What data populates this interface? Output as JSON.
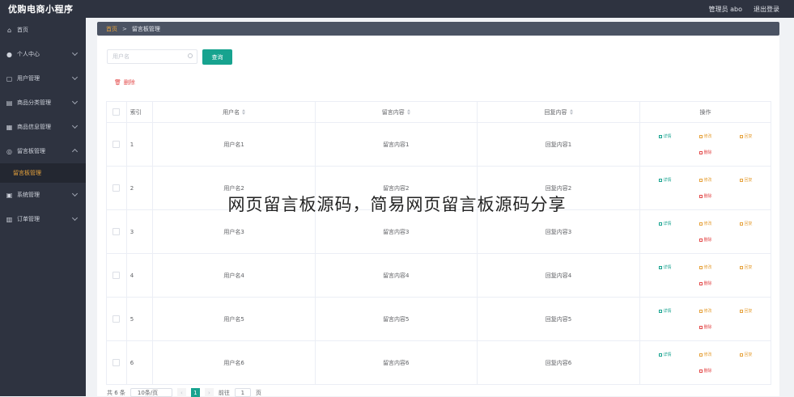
{
  "app": {
    "title": "优购电商小程序"
  },
  "header": {
    "user_label": "管理员 abo",
    "logout_label": "退出登录"
  },
  "sidebar": {
    "items": [
      {
        "label": "首页",
        "icon": "home-icon"
      },
      {
        "label": "个人中心",
        "icon": "user-icon"
      },
      {
        "label": "用户管理",
        "icon": "users-icon"
      },
      {
        "label": "商品分类管理",
        "icon": "category-icon"
      },
      {
        "label": "商品信息管理",
        "icon": "goods-icon"
      },
      {
        "label": "留言板管理",
        "icon": "message-icon",
        "expanded": true,
        "children": [
          {
            "label": "留言板管理",
            "active": true
          }
        ]
      },
      {
        "label": "系统管理",
        "icon": "system-icon"
      },
      {
        "label": "订单管理",
        "icon": "order-icon"
      }
    ]
  },
  "breadcrumb": {
    "home": "首页",
    "current": "留言板管理"
  },
  "search": {
    "placeholder": "用户名",
    "button_label": "查询"
  },
  "toolbar": {
    "delete_label": "删除"
  },
  "table": {
    "columns": {
      "index": "索引",
      "username": "用户名",
      "message": "留言内容",
      "reply": "回复内容",
      "actions": "操作"
    },
    "actions": {
      "detail": "详情",
      "edit": "修改",
      "reply": "回复",
      "delete": "删除"
    },
    "rows": [
      {
        "index": "1",
        "username": "用户名1",
        "message": "留言内容1",
        "reply": "回复内容1"
      },
      {
        "index": "2",
        "username": "用户名2",
        "message": "留言内容2",
        "reply": "回复内容2"
      },
      {
        "index": "3",
        "username": "用户名3",
        "message": "留言内容3",
        "reply": "回复内容3"
      },
      {
        "index": "4",
        "username": "用户名4",
        "message": "留言内容4",
        "reply": "回复内容4"
      },
      {
        "index": "5",
        "username": "用户名5",
        "message": "留言内容5",
        "reply": "回复内容5"
      },
      {
        "index": "6",
        "username": "用户名6",
        "message": "留言内容6",
        "reply": "回复内容6"
      }
    ]
  },
  "pagination": {
    "total": "共 6 条",
    "page_size": "10条/页",
    "current_page": "1",
    "goto_label": "前往",
    "goto_value": "1",
    "page_suffix": "页"
  },
  "overlay_text": "网页留言板源码，简易网页留言板源码分享",
  "colors": {
    "sidebar_bg": "#2e3340",
    "accent_green": "#17a38f",
    "warn_orange": "#e6a23c",
    "danger_red": "#e34b4b"
  }
}
